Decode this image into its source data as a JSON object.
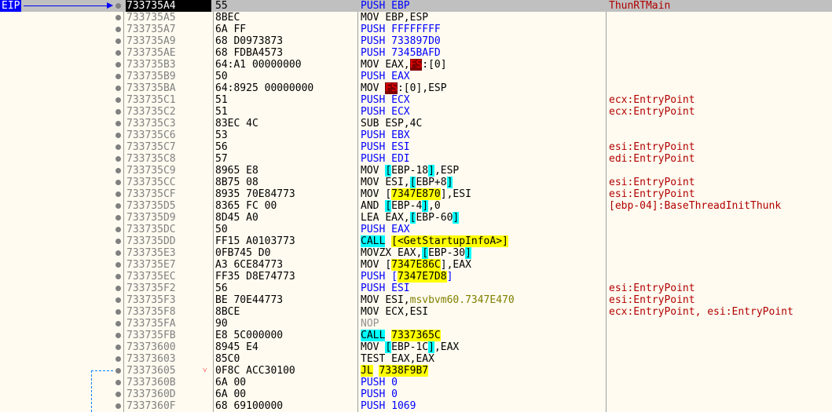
{
  "eip_label": "EIP",
  "rows": [
    {
      "addr": "733735A4",
      "bytes": "55",
      "mn": "PUSH",
      "ops": "EBP",
      "comment": "ThunRTMain",
      "selected": true
    },
    {
      "addr": "733735A5",
      "bytes": "8BEC",
      "mn": "MOV",
      "ops": "EBP,ESP",
      "comment": ""
    },
    {
      "addr": "733735A7",
      "bytes": "6A FF",
      "mn": "PUSH",
      "ops": "FFFFFFFF",
      "comment": ""
    },
    {
      "addr": "733735A9",
      "bytes": "68 D0973873",
      "mn": "PUSH",
      "ops": "733897D0",
      "comment": ""
    },
    {
      "addr": "733735AE",
      "bytes": "68 FDBA4573",
      "mn": "PUSH",
      "ops": "7345BAFD",
      "comment": ""
    },
    {
      "addr": "733735B3",
      "bytes": "64:A1 00000000",
      "mn": "MOV",
      "ops": "EAX,FS:[0]",
      "comment": ""
    },
    {
      "addr": "733735B9",
      "bytes": "50",
      "mn": "PUSH",
      "ops": "EAX",
      "comment": ""
    },
    {
      "addr": "733735BA",
      "bytes": "64:8925 00000000",
      "mn": "MOV",
      "ops": "FS:[0],ESP",
      "comment": ""
    },
    {
      "addr": "733735C1",
      "bytes": "51",
      "mn": "PUSH",
      "ops": "ECX",
      "comment": "ecx:EntryPoint"
    },
    {
      "addr": "733735C2",
      "bytes": "51",
      "mn": "PUSH",
      "ops": "ECX",
      "comment": "ecx:EntryPoint"
    },
    {
      "addr": "733735C3",
      "bytes": "83EC 4C",
      "mn": "SUB",
      "ops": "ESP,4C",
      "comment": ""
    },
    {
      "addr": "733735C6",
      "bytes": "53",
      "mn": "PUSH",
      "ops": "EBX",
      "comment": ""
    },
    {
      "addr": "733735C7",
      "bytes": "56",
      "mn": "PUSH",
      "ops": "ESI",
      "comment": "esi:EntryPoint"
    },
    {
      "addr": "733735C8",
      "bytes": "57",
      "mn": "PUSH",
      "ops": "EDI",
      "comment": "edi:EntryPoint"
    },
    {
      "addr": "733735C9",
      "bytes": "8965 E8",
      "mn": "MOV",
      "ops": "[EBP-18],ESP",
      "comment": ""
    },
    {
      "addr": "733735CC",
      "bytes": "8B75 08",
      "mn": "MOV",
      "ops": "ESI,[EBP+8]",
      "comment": "esi:EntryPoint"
    },
    {
      "addr": "733735CF",
      "bytes": "8935 70E84773",
      "mn": "MOV",
      "ops": "[7347E870],ESI",
      "comment": "esi:EntryPoint"
    },
    {
      "addr": "733735D5",
      "bytes": "8365 FC 00",
      "mn": "AND",
      "ops": "[EBP-4],0",
      "comment": "[ebp-04]:BaseThreadInitThunk"
    },
    {
      "addr": "733735D9",
      "bytes": "8D45 A0",
      "mn": "LEA",
      "ops": "EAX,[EBP-60]",
      "comment": ""
    },
    {
      "addr": "733735DC",
      "bytes": "50",
      "mn": "PUSH",
      "ops": "EAX",
      "comment": ""
    },
    {
      "addr": "733735DD",
      "bytes": "FF15 A0103773",
      "mn": "CALL",
      "ops": "[<GetStartupInfoA>]",
      "comment": ""
    },
    {
      "addr": "733735E3",
      "bytes": "0FB745 D0",
      "mn": "MOVZX",
      "ops": "EAX,[EBP-30]",
      "comment": ""
    },
    {
      "addr": "733735E7",
      "bytes": "A3 6CE84773",
      "mn": "MOV",
      "ops": "[7347E86C],EAX",
      "comment": ""
    },
    {
      "addr": "733735EC",
      "bytes": "FF35 D8E74773",
      "mn": "PUSH",
      "ops": "[7347E7D8]",
      "comment": ""
    },
    {
      "addr": "733735F2",
      "bytes": "56",
      "mn": "PUSH",
      "ops": "ESI",
      "comment": "esi:EntryPoint"
    },
    {
      "addr": "733735F3",
      "bytes": "BE 70E44773",
      "mn": "MOV",
      "ops": "ESI,msvbvm60.7347E470",
      "comment": "esi:EntryPoint"
    },
    {
      "addr": "733735F8",
      "bytes": "8BCE",
      "mn": "MOV",
      "ops": "ECX,ESI",
      "comment": "ecx:EntryPoint, esi:EntryPoint"
    },
    {
      "addr": "733735FA",
      "bytes": "90",
      "mn": "NOP",
      "ops": "",
      "comment": ""
    },
    {
      "addr": "733735FB",
      "bytes": "E8 5C000000",
      "mn": "CALL",
      "ops": "7337365C",
      "comment": ""
    },
    {
      "addr": "73373600",
      "bytes": "8945 E4",
      "mn": "MOV",
      "ops": "[EBP-1C],EAX",
      "comment": ""
    },
    {
      "addr": "73373603",
      "bytes": "85C0",
      "mn": "TEST",
      "ops": "EAX,EAX",
      "comment": ""
    },
    {
      "addr": "73373605",
      "bytes": "0F8C ACC30100",
      "mn": "JL",
      "ops": "7338F9B7",
      "comment": "",
      "jump": true
    },
    {
      "addr": "7337360B",
      "bytes": "6A 00",
      "mn": "PUSH",
      "ops": "0",
      "comment": ""
    },
    {
      "addr": "7337360D",
      "bytes": "6A 00",
      "mn": "PUSH",
      "ops": "0",
      "comment": ""
    },
    {
      "addr": "7337360F",
      "bytes": "68 69100000",
      "mn": "PUSH",
      "ops": "1069",
      "comment": ""
    }
  ]
}
